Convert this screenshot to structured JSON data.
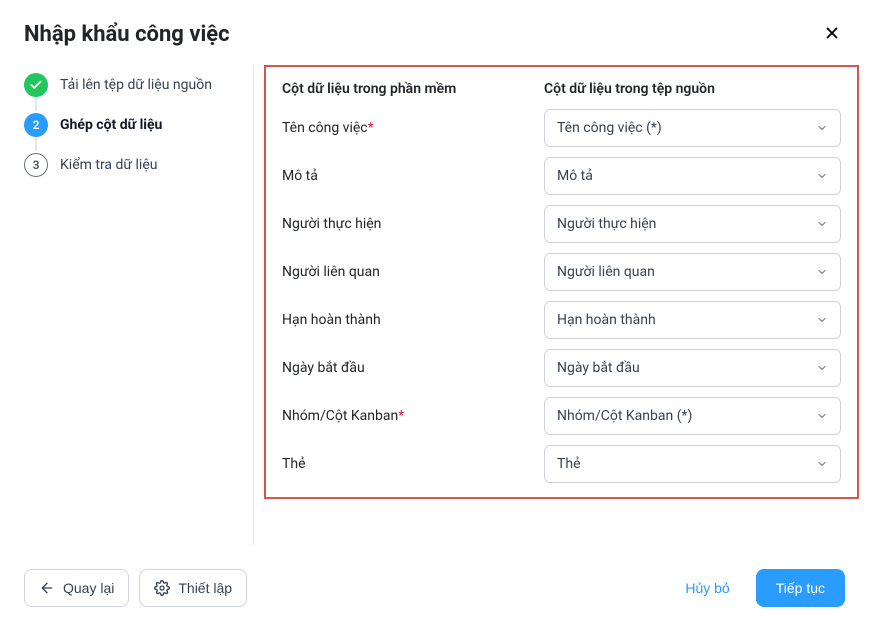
{
  "header": {
    "title": "Nhập khẩu công việc"
  },
  "steps": [
    {
      "label": "Tải lên tệp dữ liệu nguồn",
      "state": "done"
    },
    {
      "label": "Ghép cột dữ liệu",
      "state": "current"
    },
    {
      "label": "Kiểm tra dữ liệu",
      "state": "pending",
      "num": "3"
    }
  ],
  "columns": {
    "left_header": "Cột dữ liệu trong phần mềm",
    "right_header": "Cột dữ liệu trong tệp nguồn"
  },
  "rows": [
    {
      "label": "Tên công việc",
      "required": true,
      "value": "Tên công việc (*)"
    },
    {
      "label": "Mô tả",
      "required": false,
      "value": "Mô tả"
    },
    {
      "label": "Người thực hiện",
      "required": false,
      "value": "Người thực hiện"
    },
    {
      "label": "Người liên quan",
      "required": false,
      "value": "Người liên quan"
    },
    {
      "label": "Hạn hoàn thành",
      "required": false,
      "value": "Hạn hoàn thành"
    },
    {
      "label": "Ngày bắt đầu",
      "required": false,
      "value": "Ngày bắt đầu"
    },
    {
      "label": "Nhóm/Cột Kanban",
      "required": true,
      "value": "Nhóm/Cột Kanban (*)"
    },
    {
      "label": "Thẻ",
      "required": false,
      "value": "Thẻ"
    }
  ],
  "footer": {
    "back": "Quay lại",
    "settings": "Thiết lập",
    "cancel": "Hủy bỏ",
    "continue": "Tiếp tục"
  }
}
